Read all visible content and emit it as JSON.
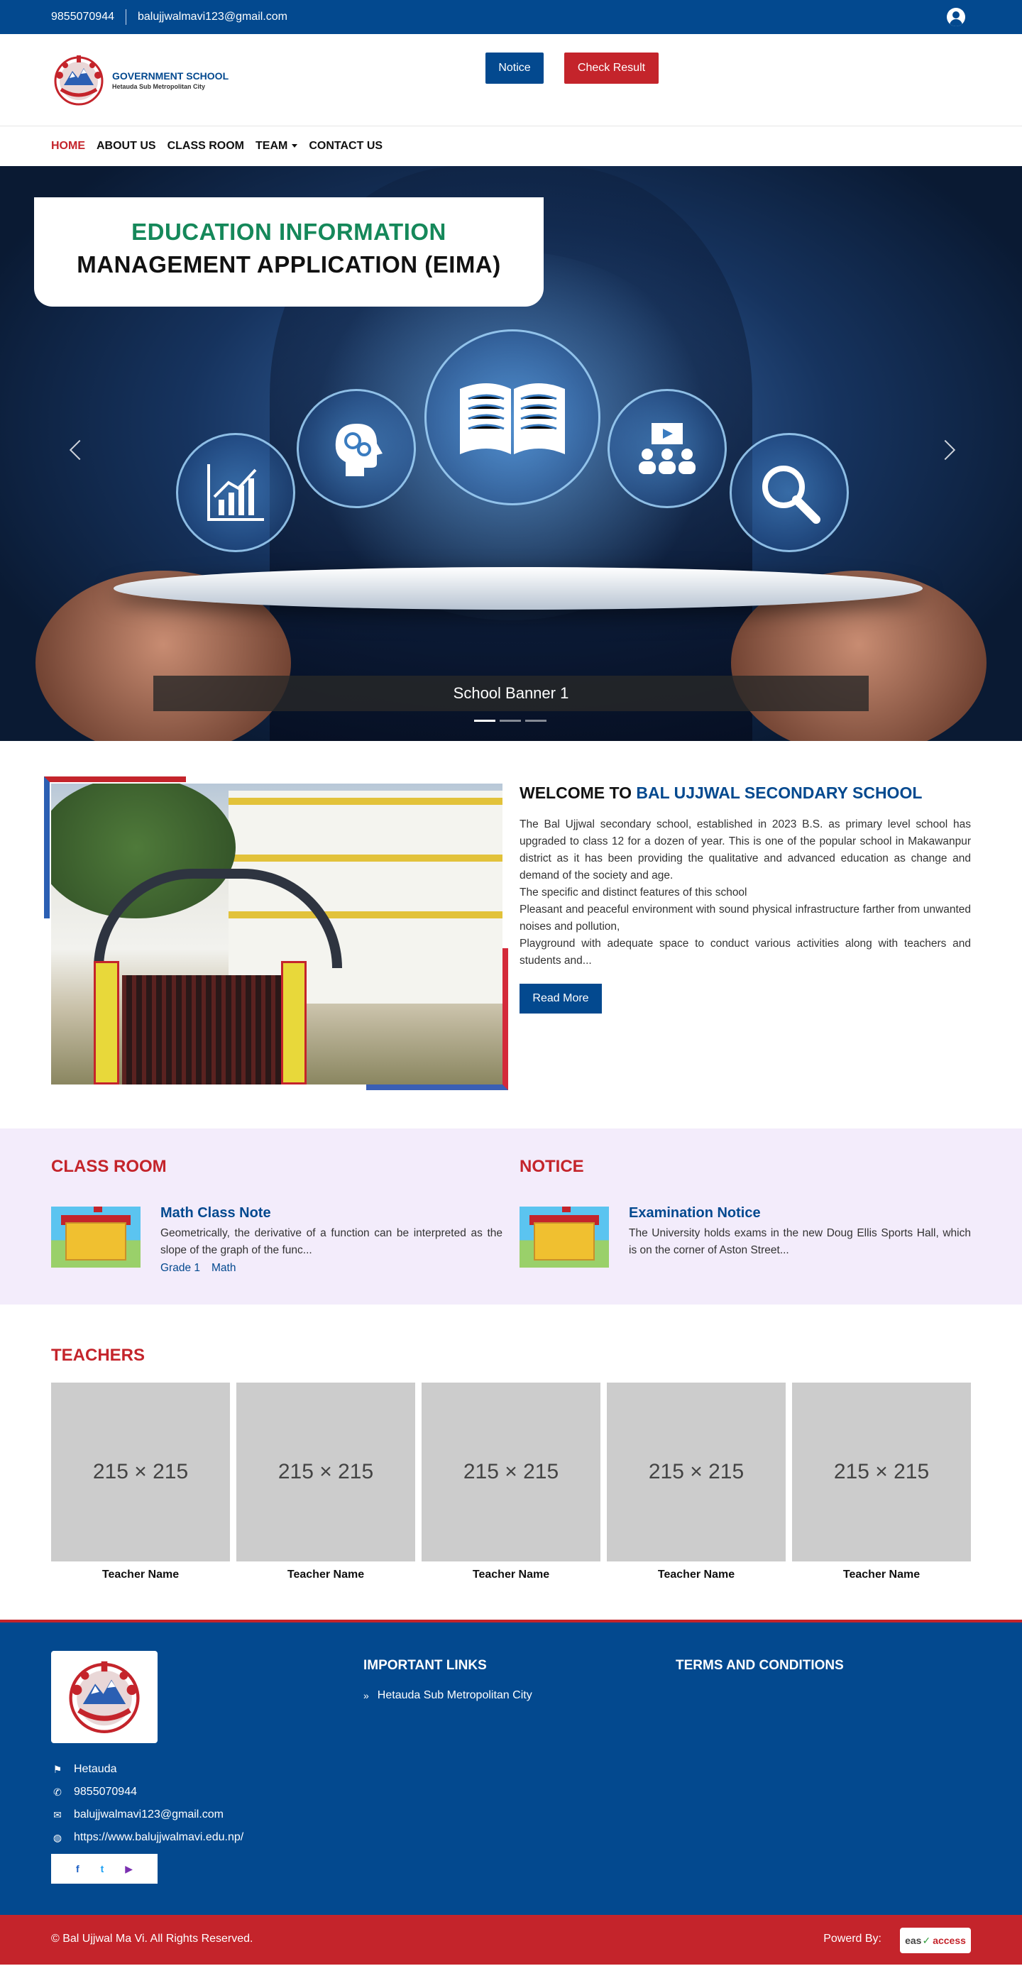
{
  "colors": {
    "primary": "#03498f",
    "accent": "#c4242b",
    "green": "#15885a",
    "lavender": "#f3ecfb"
  },
  "topbar": {
    "phone": "9855070944",
    "email": "balujjwalmavi123@gmail.com",
    "user_icon": "user-circle-icon"
  },
  "header": {
    "logo_title": "GOVERNMENT SCHOOL",
    "logo_subtitle": "Hetauda Sub Metropolitan City",
    "notice_button": "Notice",
    "result_button": "Check Result"
  },
  "nav": {
    "items": [
      "HOME",
      "ABOUT US",
      "CLASS ROOM",
      "TEAM",
      "CONTACT US"
    ],
    "active": "HOME"
  },
  "hero": {
    "title_line1": "EDUCATION INFORMATION",
    "title_line2": "MANAGEMENT APPLICATION (EIMA)",
    "caption": "School Banner 1",
    "slides": 3,
    "active_slide": 1
  },
  "welcome": {
    "heading_prefix": "WELCOME TO ",
    "heading_school": "BAL UJJWAL SECONDARY SCHOOL",
    "paragraphs": [
      "The Bal Ujjwal secondary school, established in 2023 B.S. as primary level school has upgraded to class 12 for a dozen of year. This is one of the popular school in Makawanpur district as it has been providing the qualitative and advanced education as change and demand of the society and age.",
      "The specific and distinct features of this school",
      "Pleasant and peaceful environment with sound physical infrastructure farther from unwanted noises and pollution,",
      "Playground with adequate space to  conduct various activities along with teachers and students and..."
    ],
    "read_more": "Read More"
  },
  "classroom": {
    "title": "CLASS ROOM",
    "item_title": "Math Class Note",
    "item_desc": "Geometrically, the derivative of a function can be interpreted as the slope of the graph of the func...",
    "tags": [
      "Grade 1",
      "Math"
    ]
  },
  "notice": {
    "title": "NOTICE",
    "item_title": "Examination Notice",
    "item_desc": "The University holds exams in the new Doug Ellis Sports Hall, which is on the corner of Aston Street..."
  },
  "teachers": {
    "title": "TEACHERS",
    "placeholder": "215 × 215",
    "names": [
      "Teacher Name",
      "Teacher Name",
      "Teacher Name",
      "Teacher Name",
      "Teacher Name"
    ]
  },
  "footer": {
    "address": "Hetauda",
    "phone": "9855070944",
    "email": "balujjwalmavi123@gmail.com",
    "website": "https://www.balujjwalmavi.edu.np/",
    "important_links_title": "IMPORTANT LINKS",
    "important_link": "Hetauda Sub Metropolitan City",
    "terms_title": "TERMS AND CONDITIONS",
    "social": {
      "facebook": "f",
      "twitter": "t",
      "youtube": "▶"
    }
  },
  "copyright": {
    "text": "© Bal Ujjwal Ma Vi. All Rights Reserved.",
    "powered_by": "Powerd By:",
    "brand_left": "eas",
    "brand_right": "access"
  }
}
